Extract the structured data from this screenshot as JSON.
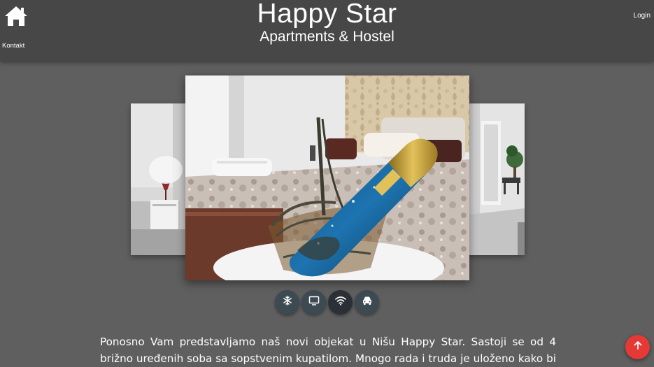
{
  "header": {
    "title": "Happy Star",
    "subtitle": "Apartments & Hostel",
    "kontakt_label": "Kontakt",
    "login_label": "Login"
  },
  "carousel": {
    "slides": [
      {
        "name": "hallway-room-left"
      },
      {
        "name": "champagne-bedroom-main"
      },
      {
        "name": "hallway-right"
      }
    ],
    "active_index": 1
  },
  "amenities": [
    {
      "icon": "snowflake-icon",
      "label": "Klima"
    },
    {
      "icon": "tv-icon",
      "label": "TV"
    },
    {
      "icon": "wifi-icon",
      "label": "WiFi"
    },
    {
      "icon": "car-icon",
      "label": "Parking"
    }
  ],
  "description": "Ponosno Vam predstavljamo naš novi objekat u Nišu Happy Star. Sastoji se od 4 brižno uređenih soba sa sopstvenim kupatilom. Mnogo rada i truda je uloženo kako bi našim",
  "colors": {
    "header_bg": "#474747",
    "page_bg": "#5f5f5f",
    "amenity_bg": "#3d4a52",
    "fab": "#e53935"
  }
}
